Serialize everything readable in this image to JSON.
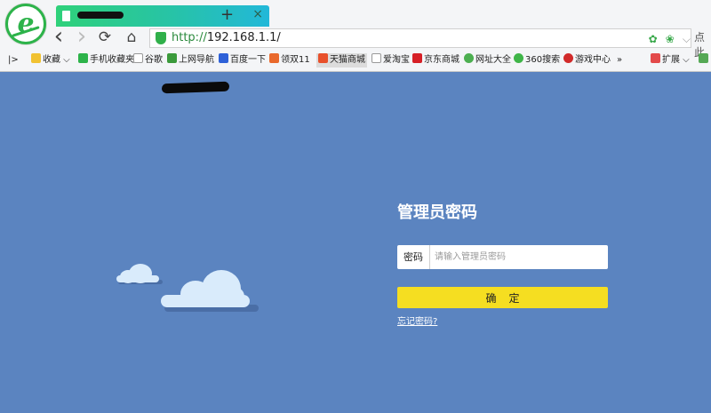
{
  "browser": {
    "logo_letter": "e",
    "tab": {
      "close_glyph": "×"
    },
    "new_tab_glyph": "+",
    "nav": {
      "back": "‹",
      "forward": "›",
      "reload": "⟳",
      "home": "⌂"
    },
    "url": {
      "scheme": "http://",
      "host": "192.168.1.1/"
    },
    "url_actions": {
      "tool1": "✿",
      "tool2": "❀",
      "dropdown": "⌵"
    },
    "search_stub": "点此",
    "bookmarks": [
      {
        "label": "|>",
        "color": "#666"
      },
      {
        "label": "收藏 ⌵",
        "color": "#f1c232"
      },
      {
        "label": "手机收藏夹",
        "color": "#2db34a"
      },
      {
        "label": "谷歌",
        "color": "#bbbbbb"
      },
      {
        "label": "上网导航",
        "color": "#3b9a3b"
      },
      {
        "label": "百度一下",
        "color": "#2e61d8"
      },
      {
        "label": "领双11",
        "color": "#e9692c"
      },
      {
        "label": "天猫商城",
        "color": "#e8502b"
      },
      {
        "label": "爱淘宝",
        "color": "#bbbbbb"
      },
      {
        "label": "京东商城",
        "color": "#d61f26"
      },
      {
        "label": "网址大全",
        "color": "#4caf50"
      },
      {
        "label": "360搜索",
        "color": "#3fb548"
      },
      {
        "label": "游戏中心",
        "color": "#d12a2a"
      },
      {
        "label": "»",
        "color": "#666"
      },
      {
        "label": "扩展 ⌵",
        "color": "#e34a4a"
      },
      {
        "label": "",
        "color": "#55a855"
      }
    ]
  },
  "login": {
    "title": "管理员密码",
    "password_label": "密码",
    "password_placeholder": "请输入管理员密码",
    "password_value": "",
    "confirm_label": "确定",
    "forgot_link": "忘记密码?"
  }
}
